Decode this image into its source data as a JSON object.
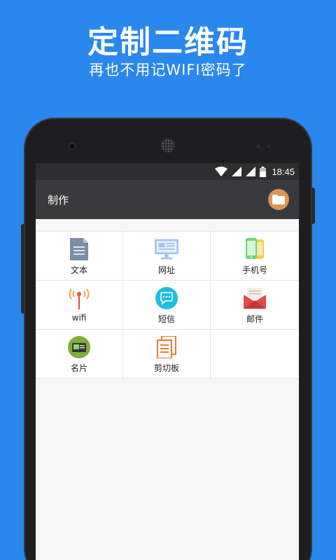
{
  "promo": {
    "title": "定制二维码",
    "subtitle": "再也不用记WIFI密码了"
  },
  "statusbar": {
    "time": "18:45",
    "icons": [
      "wifi-icon",
      "signal-icon",
      "signal-icon",
      "battery-icon"
    ]
  },
  "toolbar": {
    "title": "制作",
    "folder_icon": "folder-icon"
  },
  "grid": {
    "items": [
      {
        "label": "文本",
        "icon": "document-icon"
      },
      {
        "label": "网址",
        "icon": "monitor-icon"
      },
      {
        "label": "手机号",
        "icon": "phone-icon"
      },
      {
        "label": "wifi",
        "icon": "wifi-antenna-icon"
      },
      {
        "label": "短信",
        "icon": "chat-bubble-icon"
      },
      {
        "label": "邮件",
        "icon": "mail-icon"
      },
      {
        "label": "名片",
        "icon": "business-card-icon"
      },
      {
        "label": "剪切板",
        "icon": "clipboard-icon"
      }
    ]
  },
  "colors": {
    "background": "#2a87ee",
    "toolbar": "#3a3a3c",
    "statusbar": "#2e2e30",
    "folder_button": "#e0935a"
  }
}
